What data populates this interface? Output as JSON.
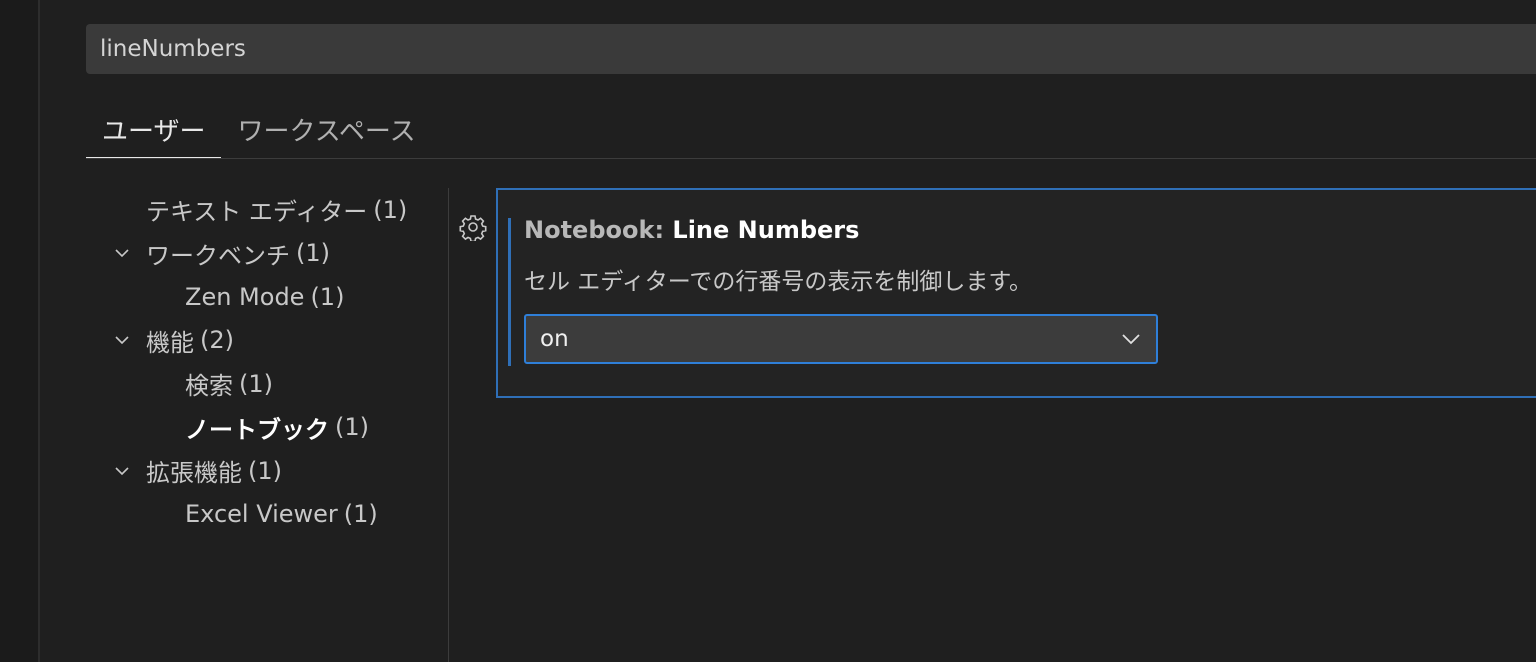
{
  "search": {
    "value": "lineNumbers"
  },
  "tabs": [
    {
      "label": "ユーザー",
      "active": true
    },
    {
      "label": "ワークスペース",
      "active": false
    }
  ],
  "toc": [
    {
      "label": "テキスト エディター",
      "count": "(1)",
      "expandable": false,
      "level": 0
    },
    {
      "label": "ワークベンチ",
      "count": "(1)",
      "expandable": true,
      "level": 0
    },
    {
      "label": "Zen Mode",
      "count": "(1)",
      "expandable": false,
      "level": 1
    },
    {
      "label": "機能",
      "count": "(2)",
      "expandable": true,
      "level": 0
    },
    {
      "label": "検索",
      "count": "(1)",
      "expandable": false,
      "level": 1
    },
    {
      "label": "ノートブック",
      "count": "(1)",
      "expandable": false,
      "level": 1,
      "selected": true
    },
    {
      "label": "拡張機能",
      "count": "(1)",
      "expandable": true,
      "level": 0
    },
    {
      "label": "Excel Viewer",
      "count": "(1)",
      "expandable": false,
      "level": 1
    }
  ],
  "setting": {
    "category": "Notebook: ",
    "name": "Line Numbers",
    "description": "セル エディターでの行番号の表示を制御します。",
    "selected_value": "on",
    "icon": "gear-icon"
  },
  "colors": {
    "accent": "#2f7fd8",
    "background": "#1f1f1f"
  }
}
